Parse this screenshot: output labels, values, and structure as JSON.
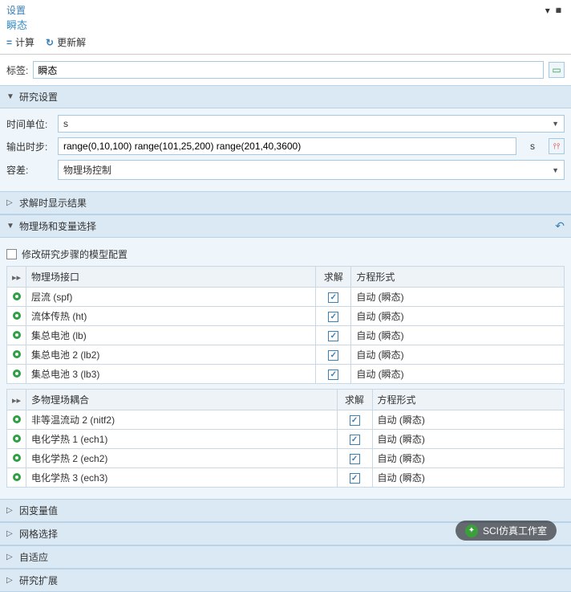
{
  "title": "设置",
  "subtitle": "瞬态",
  "toolbar": {
    "compute": "计算",
    "update": "更新解"
  },
  "labelRow": {
    "label": "标签:",
    "value": "瞬态"
  },
  "sections": {
    "studySettings": {
      "title": "研究设置",
      "timeUnitLabel": "时间单位:",
      "timeUnitValue": "s",
      "outputTimesLabel": "输出时步:",
      "outputTimesValue": "range(0,10,100) range(101,25,200) range(201,40,3600)",
      "outputTimesUnit": "s",
      "toleranceLabel": "容差:",
      "toleranceValue": "物理场控制"
    },
    "resultsWhileSolving": "求解时显示结果",
    "physicsSelection": {
      "title": "物理场和变量选择",
      "modifyCheckbox": "修改研究步骤的模型配置",
      "headers": {
        "interface": "物理场接口",
        "solve": "求解",
        "eqForm": "方程形式"
      },
      "rows": [
        {
          "name": "层流 (spf)",
          "eq": "自动 (瞬态)"
        },
        {
          "name": "流体传热 (ht)",
          "eq": "自动 (瞬态)"
        },
        {
          "name": "集总电池 (lb)",
          "eq": "自动 (瞬态)"
        },
        {
          "name": "集总电池 2 (lb2)",
          "eq": "自动 (瞬态)"
        },
        {
          "name": "集总电池 3 (lb3)",
          "eq": "自动 (瞬态)"
        }
      ],
      "headers2": {
        "interface": "多物理场耦合",
        "solve": "求解",
        "eqForm": "方程形式"
      },
      "rows2": [
        {
          "name": "非等温流动 2 (nitf2)",
          "eq": "自动 (瞬态)"
        },
        {
          "name": "电化学热 1 (ech1)",
          "eq": "自动 (瞬态)"
        },
        {
          "name": "电化学热 2 (ech2)",
          "eq": "自动 (瞬态)"
        },
        {
          "name": "电化学热 3 (ech3)",
          "eq": "自动 (瞬态)"
        }
      ]
    },
    "depVarValues": "因变量值",
    "meshSelection": "网格选择",
    "adaptation": "自适应",
    "studyExtensions": "研究扩展"
  },
  "watermark": "SCI仿真工作室"
}
